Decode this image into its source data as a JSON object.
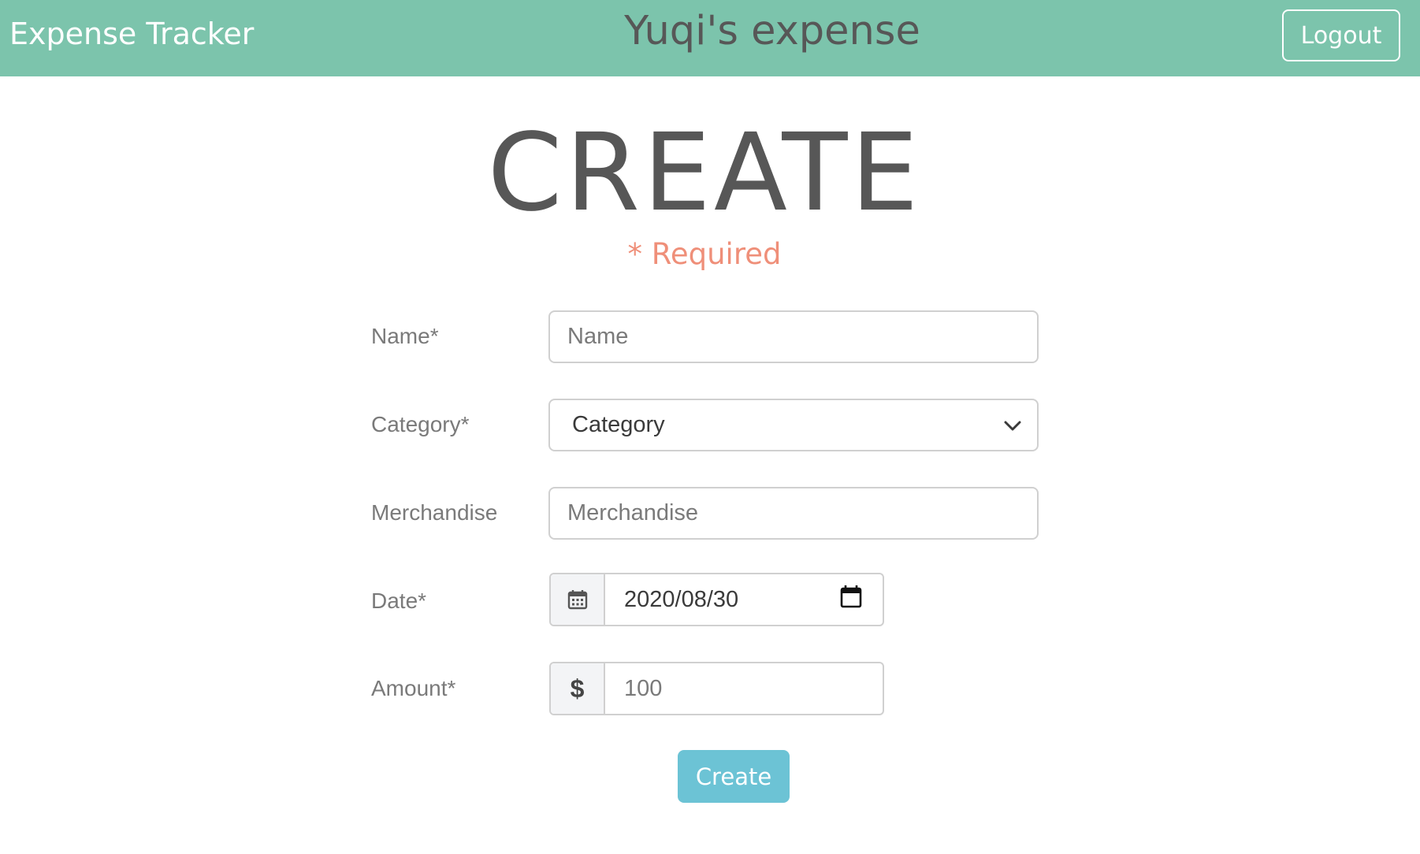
{
  "navbar": {
    "brand": "Expense Tracker",
    "title": "Yuqi's expense",
    "logout_label": "Logout",
    "background": "#7cc4ac"
  },
  "page": {
    "title": "CREATE",
    "required_note": "* Required"
  },
  "form": {
    "name": {
      "label": "Name*",
      "placeholder": "Name"
    },
    "category": {
      "label": "Category*",
      "selected": "Category"
    },
    "merchandise": {
      "label": "Merchandise",
      "placeholder": "Merchandise"
    },
    "date": {
      "label": "Date*",
      "value": "2020/08/30",
      "addon_icon": "calendar-icon",
      "picker_icon": "calendar-picker-icon"
    },
    "amount": {
      "label": "Amount*",
      "placeholder": "100",
      "addon_icon": "dollar-icon",
      "addon_text": "$"
    },
    "submit_label": "Create"
  },
  "colors": {
    "accent_navbar": "#7cc4ac",
    "required_text": "#ef8f79",
    "create_button": "#6cc3d5"
  }
}
